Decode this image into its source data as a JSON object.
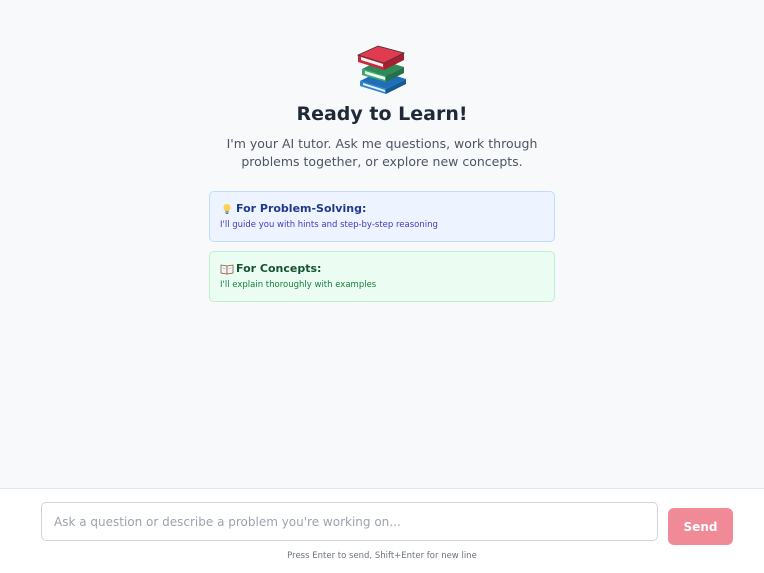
{
  "hero": {
    "icon": "books-icon",
    "title": "Ready to Learn!",
    "subtitle": "I'm your AI tutor. Ask me questions, work through problems together, or explore new concepts."
  },
  "cards": {
    "problem": {
      "icon": "lightbulb-icon",
      "heading": "For Problem-Solving:",
      "description": "I'll guide you with hints and step-by-step reasoning"
    },
    "concept": {
      "icon": "open-book-icon",
      "heading": "For Concepts:",
      "description": "I'll explain thoroughly with examples"
    }
  },
  "composer": {
    "placeholder": "Ask a question or describe a problem you're working on...",
    "value": "",
    "send_label": "Send",
    "hint": "Press Enter to send, Shift+Enter for new line"
  },
  "colors": {
    "accent": "#f08a97",
    "problem_bg": "#edf4ff",
    "concept_bg": "#ebfdf2"
  }
}
